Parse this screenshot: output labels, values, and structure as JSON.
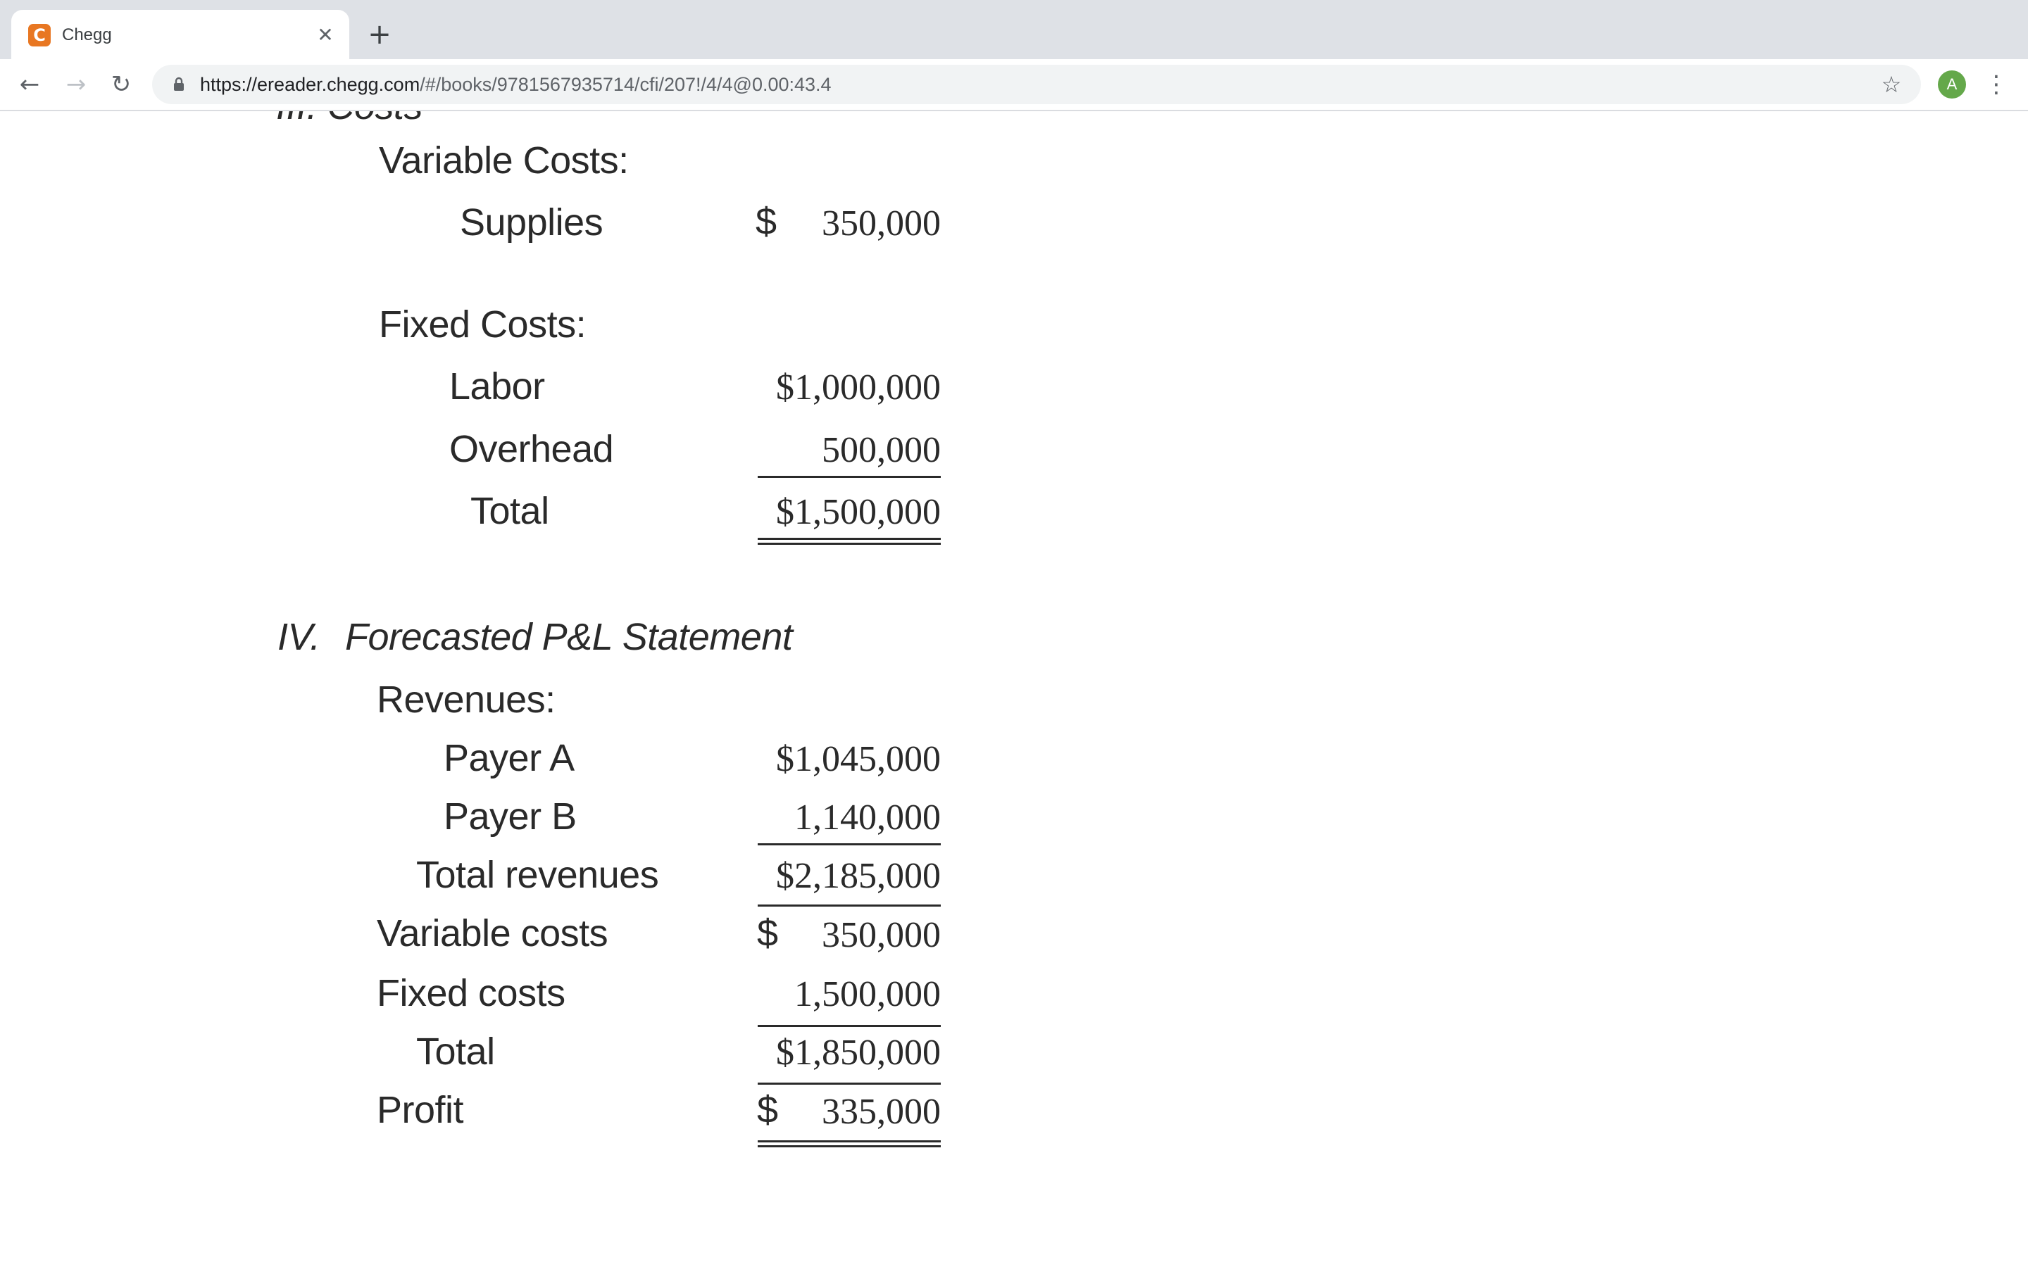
{
  "browser": {
    "tab_title": "Chegg",
    "favicon_letter": "C",
    "url_host": "https://ereader.chegg.com",
    "url_path": "/#/books/9781567935714/cfi/207!/4/4@0.00:43.4",
    "profile_initial": "A",
    "close_glyph": "✕",
    "newtab_glyph": "+",
    "back_glyph": "←",
    "forward_glyph": "→",
    "reload_glyph": "↻",
    "star_glyph": "☆",
    "menu_glyph": "⋮"
  },
  "section_iii": {
    "heading_partial": "III.   Costs",
    "variable_label": "Variable Costs:",
    "supplies_label": "Supplies",
    "supplies_dollar": "$",
    "supplies_value": "350,000",
    "fixed_label": "Fixed Costs:",
    "labor_label": "Labor",
    "labor_value": "$1,000,000",
    "overhead_label": "Overhead",
    "overhead_value": "500,000",
    "total_label": "Total",
    "total_value": "$1,500,000"
  },
  "section_iv": {
    "number": "IV.",
    "title": "Forecasted P&L Statement",
    "revenues_label": "Revenues:",
    "payer_a_label": "Payer A",
    "payer_a_value": "$1,045,000",
    "payer_b_label": "Payer B",
    "payer_b_value": "1,140,000",
    "total_revenues_label": "Total revenues",
    "total_revenues_value": "$2,185,000",
    "variable_costs_label": "Variable costs",
    "variable_costs_dollar": "$",
    "variable_costs_value": "350,000",
    "fixed_costs_label": "Fixed costs",
    "fixed_costs_value": "1,500,000",
    "total_label": "Total",
    "total_value": "$1,850,000",
    "profit_label": "Profit",
    "profit_dollar": "$",
    "profit_value": "335,000"
  }
}
